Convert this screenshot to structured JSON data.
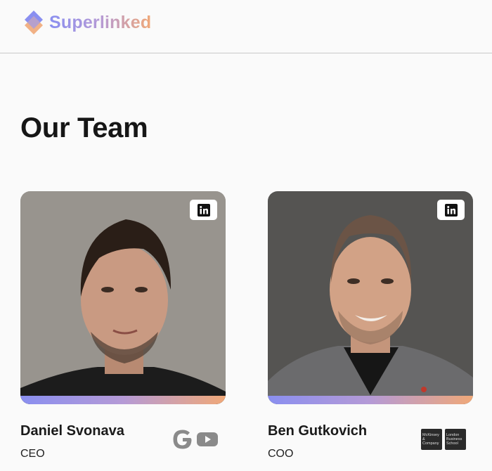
{
  "brand": {
    "name": "Superlinked"
  },
  "page": {
    "title": "Our Team"
  },
  "team": [
    {
      "name": "Daniel Svonava",
      "role": "CEO",
      "previous_employers": [
        "google-logo",
        "youtube-logo"
      ]
    },
    {
      "name": "Ben Gutkovich",
      "role": "COO",
      "previous_employers": [
        "McKinsey & Company",
        "London Business School"
      ]
    }
  ],
  "colors": {
    "accent_start": "#8a8ff0",
    "accent_mid": "#b59ad6",
    "accent_end": "#f0a878"
  }
}
